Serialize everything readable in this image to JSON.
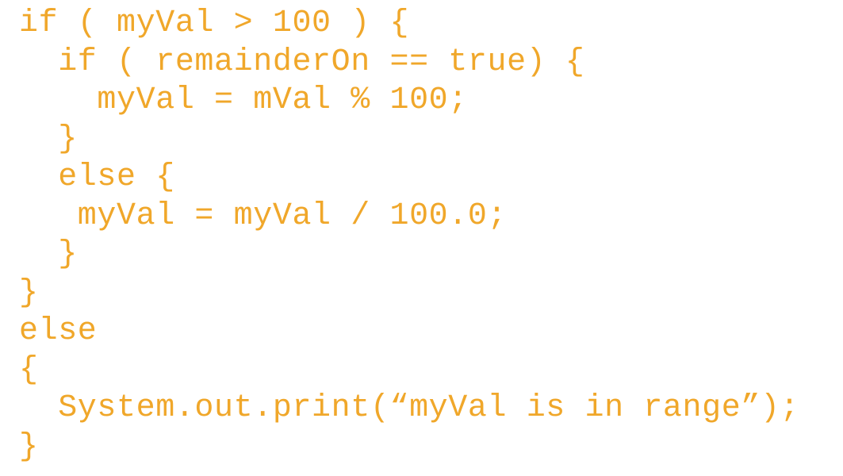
{
  "code": {
    "text_color": "#f0a72a",
    "background_color": "#ffffff",
    "lines": [
      "if ( myVal > 100 ) {",
      "  if ( remainderOn == true) {",
      "    myVal = mVal % 100;",
      "  }",
      "  else {",
      "   myVal = myVal / 100.0;",
      "  }",
      "}",
      "else",
      "{",
      "  System.out.print(“myVal is in range”);",
      "}"
    ]
  }
}
